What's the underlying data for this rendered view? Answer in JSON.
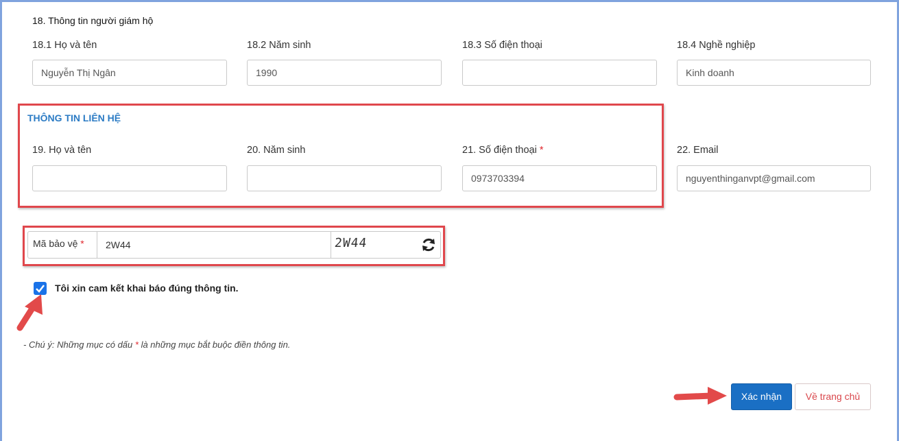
{
  "guardian": {
    "section_title": "18. Thông tin người giám hộ",
    "name_label": "18.1 Họ và tên",
    "name_value": "Nguyễn Thị Ngân",
    "birth_label": "18.2 Năm sinh",
    "birth_value": "1990",
    "phone_label": "18.3 Số điện thoại",
    "phone_value": "",
    "job_label": "18.4 Nghề nghiệp",
    "job_value": "Kinh doanh"
  },
  "contact": {
    "section_title": "THÔNG TIN LIÊN HỆ",
    "name_label": "19. Họ và tên",
    "name_value": "",
    "birth_label": "20. Năm sinh",
    "birth_value": "",
    "phone_label": "21. Số điện thoại",
    "phone_value": "0973703394",
    "email_label": "22. Email",
    "email_value": "nguyenthinganvpt@gmail.com",
    "required_mark": "*"
  },
  "captcha": {
    "label": "Mã bảo vệ",
    "required_mark": "*",
    "input_value": "2W44",
    "image_text": "2W44",
    "refresh_icon": "refresh-icon"
  },
  "commitment": {
    "checked": true,
    "label": "Tôi xin cam kết khai báo đúng thông tin."
  },
  "note": {
    "prefix": "- Chú ý: Những mục có dấu",
    "star": "*",
    "suffix": "là những mục bắt buộc điền thông tin."
  },
  "actions": {
    "confirm_label": "Xác nhận",
    "home_label": "Về trang chủ"
  },
  "colors": {
    "accent_blue": "#1a6fc4",
    "highlight_red": "#e0474c",
    "required_red": "#e0272d",
    "frame_blue": "#7fa3de"
  }
}
